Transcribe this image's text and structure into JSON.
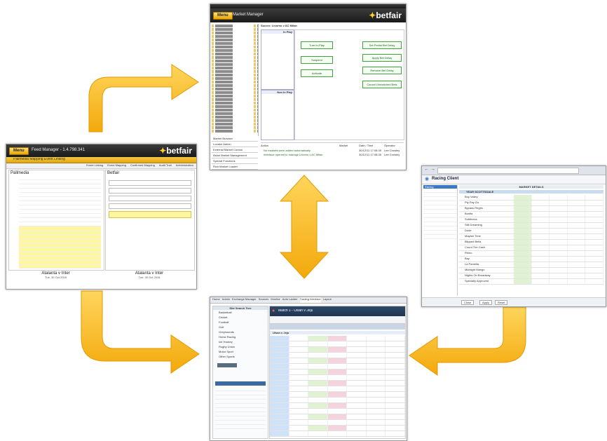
{
  "colors": {
    "arrow_fill": "#f6b61a",
    "arrow_edge": "#e79b00",
    "header_yellow": "#e8b21c",
    "dark_bar": "#1f1f1f"
  },
  "left_panel": {
    "menu_label": "Menu",
    "title": "Feed Manager - 1.4.798.341",
    "brand": "betfair",
    "subtitle": "Pallmedia Mapping Event Linking",
    "toolbar": [
      "Event Linking",
      "Event Mapping",
      "Confirmed Mapping",
      "Audit Trail",
      "Administration"
    ],
    "left_header": "Pallmedia",
    "right_header": "Betfair",
    "event_title": "Atalanta v Inter",
    "event_date": "Tue, 30 Oct 2018",
    "event_title_right": "Atalanta v Inter",
    "event_date_right": "Tue, 30 Oct 2018"
  },
  "top_panel": {
    "menu_label": "Menu",
    "title": "Market Manager",
    "brand": "betfair",
    "header_status": "Soccer: Livorno v AC Milan",
    "in_play": "In Play",
    "non_in_play": "Non In Play",
    "buttons": [
      "Turn In-Play",
      "Suspend",
      "Activate",
      "Set Perlist Bet Delay",
      "Apply Bet Delay",
      "Remove Bet Delay",
      "Cancel Unmatched Bets"
    ],
    "menu_items": [
      "Market Browser",
      "Locator Admin",
      "External Market Control",
      "Asian Market Management",
      "Special Functions",
      "Rich Market Loader"
    ],
    "log_cols": [
      "Action",
      "Market",
      "Date / Time",
      "Operator"
    ],
    "log_rows": [
      {
        "action": "No markets were added automatically",
        "time": "30/12/11 17:08:35",
        "op": "Lee Crowley"
      },
      {
        "action": "Interface opened to manage Livorno v AC Milan",
        "time": "30/12/11 17:08:35",
        "op": "Lee Crowley"
      }
    ]
  },
  "right_panel": {
    "url": "betfaircareers.co.uk/racing.jsp",
    "title": "Racing Client",
    "tab": "Racing",
    "header": "MARKET DETAILS",
    "market_name": "YEAR SCOTTSDALE",
    "runners": [
      "Boy Valley",
      "Pty Pay Go",
      "Bypass Reges",
      "Bonita",
      "Subtiness",
      "Still Dreaming",
      "Dude",
      "Mayfair Time",
      "Blipped Bella",
      "Count The Cash",
      "Rhino",
      "Bay",
      "La Pamelia",
      "Midnight Mango",
      "Nights On Broadway",
      "Specially Approved"
    ],
    "footer_buttons": [
      "Close",
      "Apply",
      "Reset"
    ]
  },
  "bottom_panel": {
    "tabs": [
      "Home",
      "Admin",
      "Exchange Manager",
      "Sources",
      "Monitor",
      "Auto Ladder",
      "Trading Interface",
      "Layout"
    ],
    "search_title": "Site Search Tree",
    "sports": [
      "Basketball",
      "Cricket",
      "Football",
      "Golf",
      "Greyhounds",
      "Horse Racing",
      "Ice Hockey",
      "Rugby Union",
      "Motor Sport",
      "Other Sports"
    ],
    "event_title": "Match 1 - Ulsan v Jeju",
    "selection": "Ulsan v Jeju"
  }
}
